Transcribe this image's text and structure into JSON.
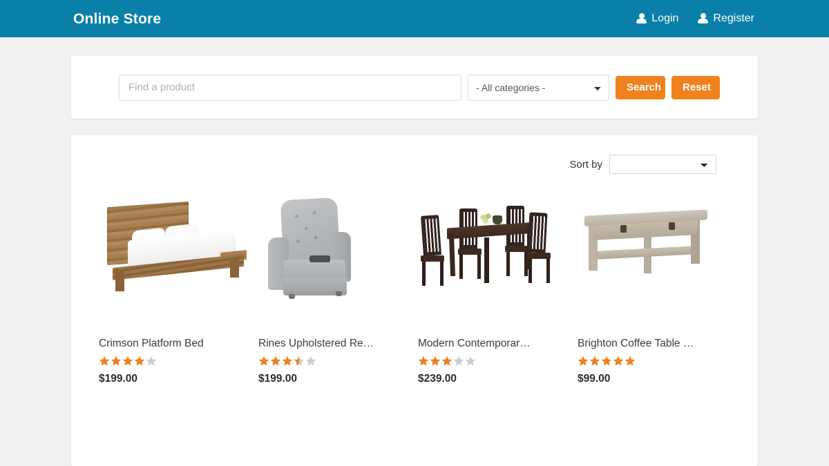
{
  "header": {
    "brand": "Online Store",
    "nav": [
      {
        "label": "Login",
        "icon": "user-icon"
      },
      {
        "label": "Register",
        "icon": "user-icon"
      }
    ]
  },
  "search": {
    "placeholder": "Find a product",
    "value": "",
    "category_selected": "- All categories -",
    "category_options": [
      "- All categories -"
    ],
    "search_label": "Search",
    "reset_label": "Reset"
  },
  "products_panel": {
    "sort_label": "Sort by",
    "sort_selected": "",
    "sort_options": [
      ""
    ],
    "items": [
      {
        "title": "Crimson Platform Bed",
        "price": "$199.00",
        "rating": 4,
        "image": "wooden-platform-bed"
      },
      {
        "title": "Rines Upholstered Re…",
        "price": "$199.00",
        "rating": 3.5,
        "image": "gray-recliner-chair"
      },
      {
        "title": "Modern Contemporar…",
        "price": "$239.00",
        "rating": 3,
        "image": "dark-dining-table-set"
      },
      {
        "title": "Brighton Coffee Table …",
        "price": "$99.00",
        "rating": 5,
        "image": "gray-coffee-table"
      }
    ]
  },
  "colors": {
    "header_bg": "#0a7fa8",
    "button_orange": "#f0821e",
    "star_filled": "#ef7f1f",
    "star_empty": "#cccccc",
    "page_bg": "#f0f0f0",
    "card_bg": "#ffffff"
  }
}
